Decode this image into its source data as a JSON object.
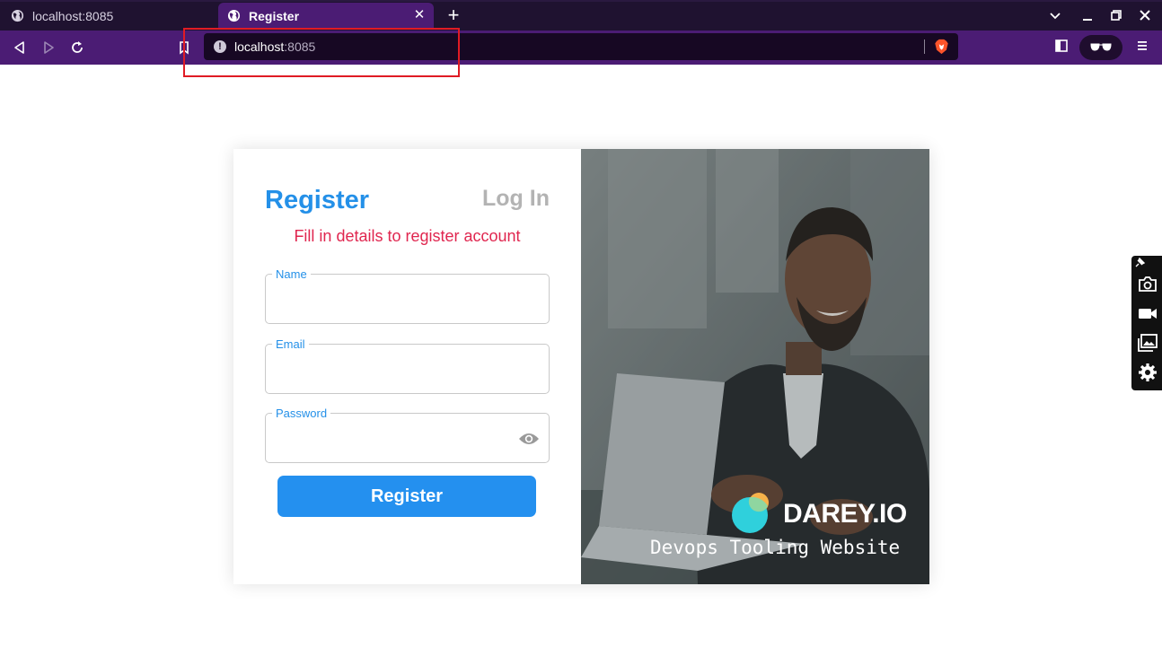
{
  "browser": {
    "tabs": [
      {
        "title": "localhost:8085",
        "active": false
      },
      {
        "title": "Register",
        "active": true
      }
    ],
    "url_host": "localhost",
    "url_port": ":8085"
  },
  "form": {
    "register_tab": "Register",
    "login_tab": "Log In",
    "subtitle": "Fill in details to register account",
    "fields": [
      {
        "label": "Name",
        "value": ""
      },
      {
        "label": "Email",
        "value": ""
      },
      {
        "label": "Password",
        "value": ""
      }
    ],
    "submit_label": "Register"
  },
  "brand": {
    "logo_text": "DAREY.IO",
    "tagline": "Devops Tooling Website"
  },
  "colors": {
    "accent": "#2490e8",
    "subtitle": "#e0264f",
    "inactive_tab": "#b3b3b3",
    "browser_toolbar": "#4b1c74",
    "highlight": "#e01b24"
  }
}
